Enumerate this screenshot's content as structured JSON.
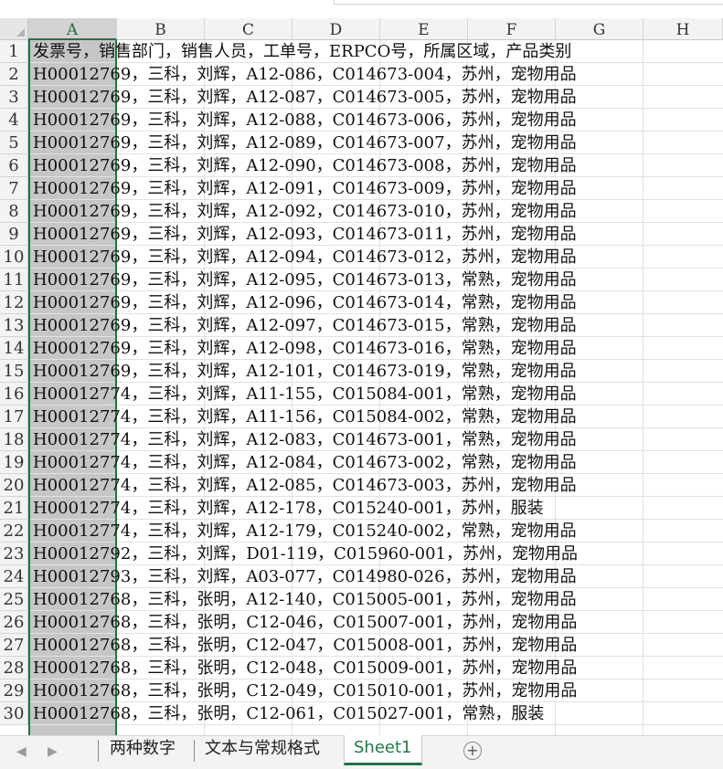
{
  "columns": [
    "A",
    "B",
    "C",
    "D",
    "E",
    "F",
    "G",
    "H"
  ],
  "header_row_text": "发票号，销售部门，销售人员，工单号，ERPCO号，所属区域，产品类别",
  "rows": [
    {
      "num": "1",
      "text": "发票号，销售部门，销售人员，工单号，ERPCO号，所属区域，产品类别"
    },
    {
      "num": "2",
      "text": "H00012769，三科，刘辉，A12-086，C014673-004，苏州，宠物用品"
    },
    {
      "num": "3",
      "text": "H00012769，三科，刘辉，A12-087，C014673-005，苏州，宠物用品"
    },
    {
      "num": "4",
      "text": "H00012769，三科，刘辉，A12-088，C014673-006，苏州，宠物用品"
    },
    {
      "num": "5",
      "text": "H00012769，三科，刘辉，A12-089，C014673-007，苏州，宠物用品"
    },
    {
      "num": "6",
      "text": "H00012769，三科，刘辉，A12-090，C014673-008，苏州，宠物用品"
    },
    {
      "num": "7",
      "text": "H00012769，三科，刘辉，A12-091，C014673-009，苏州，宠物用品"
    },
    {
      "num": "8",
      "text": "H00012769，三科，刘辉，A12-092，C014673-010，苏州，宠物用品"
    },
    {
      "num": "9",
      "text": "H00012769，三科，刘辉，A12-093，C014673-011，苏州，宠物用品"
    },
    {
      "num": "10",
      "text": "H00012769，三科，刘辉，A12-094，C014673-012，苏州，宠物用品"
    },
    {
      "num": "11",
      "text": "H00012769，三科，刘辉，A12-095，C014673-013，常熟，宠物用品"
    },
    {
      "num": "12",
      "text": "H00012769，三科，刘辉，A12-096，C014673-014，常熟，宠物用品"
    },
    {
      "num": "13",
      "text": "H00012769，三科，刘辉，A12-097，C014673-015，常熟，宠物用品"
    },
    {
      "num": "14",
      "text": "H00012769，三科，刘辉，A12-098，C014673-016，常熟，宠物用品"
    },
    {
      "num": "15",
      "text": "H00012769，三科，刘辉，A12-101，C014673-019，常熟，宠物用品"
    },
    {
      "num": "16",
      "text": "H00012774，三科，刘辉，A11-155，C015084-001，常熟，宠物用品"
    },
    {
      "num": "17",
      "text": "H00012774，三科，刘辉，A11-156，C015084-002，常熟，宠物用品"
    },
    {
      "num": "18",
      "text": "H00012774，三科，刘辉，A12-083，C014673-001，常熟，宠物用品"
    },
    {
      "num": "19",
      "text": "H00012774，三科，刘辉，A12-084，C014673-002，常熟，宠物用品"
    },
    {
      "num": "20",
      "text": "H00012774，三科，刘辉，A12-085，C014673-003，苏州，宠物用品"
    },
    {
      "num": "21",
      "text": "H00012774，三科，刘辉，A12-178，C015240-001，苏州，服装"
    },
    {
      "num": "22",
      "text": "H00012774，三科，刘辉，A12-179，C015240-002，常熟，宠物用品"
    },
    {
      "num": "23",
      "text": "H00012792，三科，刘辉，D01-119，C015960-001，苏州，宠物用品"
    },
    {
      "num": "24",
      "text": "H00012793，三科，刘辉，A03-077，C014980-026，苏州，宠物用品"
    },
    {
      "num": "25",
      "text": "H00012768，三科，张明，A12-140，C015005-001，苏州，宠物用品"
    },
    {
      "num": "26",
      "text": "H00012768，三科，张明，C12-046，C015007-001，苏州，宠物用品"
    },
    {
      "num": "27",
      "text": "H00012768，三科，张明，C12-047，C015008-001，苏州，宠物用品"
    },
    {
      "num": "28",
      "text": "H00012768，三科，张明，C12-048，C015009-001，苏州，宠物用品"
    },
    {
      "num": "29",
      "text": "H00012768，三科，张明，C12-049，C015010-001，苏州，宠物用品"
    },
    {
      "num": "30",
      "text": "H00012768，三科，张明，C12-061，C015027-001，常熟，服装"
    }
  ],
  "sheet_tabs": [
    "两种数字",
    "文本与常规格式",
    "Sheet1"
  ],
  "active_tab": "Sheet1",
  "nav_left": "◀",
  "nav_right": "▶",
  "add_sheet": "+",
  "accent_color": "#217346"
}
